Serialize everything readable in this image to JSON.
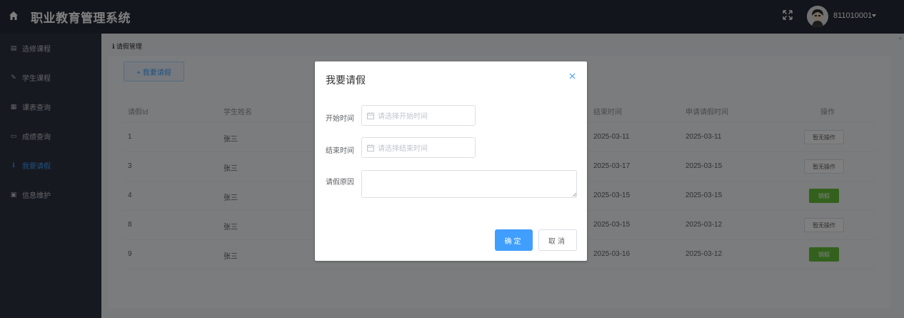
{
  "header": {
    "title": "职业教育管理系统",
    "username": "811010001",
    "home_icon": "home-icon",
    "fullscreen_icon": "fullscreen-icon"
  },
  "sidebar": {
    "items": [
      {
        "label": "选修课程",
        "icon": "book-icon"
      },
      {
        "label": "学生课程",
        "icon": "edit-icon"
      },
      {
        "label": "课表查询",
        "icon": "calendar-icon"
      },
      {
        "label": "成绩查询",
        "icon": "table-icon"
      },
      {
        "label": "我要请假",
        "icon": "info-icon",
        "active": true
      },
      {
        "label": "信息维护",
        "icon": "document-icon"
      }
    ]
  },
  "breadcrumb": "请假管理",
  "toolbar": {
    "add_label": "+ 我要请假"
  },
  "table": {
    "headers": [
      "请假Id",
      "学生姓名",
      "结束时间",
      "申请请假时间",
      "操作"
    ],
    "rows": [
      {
        "id": "1",
        "name": "张三",
        "end": "2025-03-11",
        "applied": "2025-03-11",
        "action": "暂无操作"
      },
      {
        "id": "3",
        "name": "张三",
        "end": "2025-03-17",
        "applied": "2025-03-15",
        "action": "暂无操作"
      },
      {
        "id": "4",
        "name": "张三",
        "end": "2025-03-15",
        "applied": "2025-03-15",
        "action": "销假"
      },
      {
        "id": "8",
        "name": "张三",
        "end": "2025-03-15",
        "applied": "2025-03-12",
        "action": "暂无操作"
      },
      {
        "id": "9",
        "name": "张三",
        "end": "2025-03-16",
        "applied": "2025-03-12",
        "action": "销假"
      }
    ]
  },
  "dialog": {
    "title": "我要请假",
    "start_label": "开始时间",
    "start_placeholder": "请选择开始时间",
    "end_label": "结束时间",
    "end_placeholder": "请选择结束时间",
    "reason_label": "请假原因",
    "reason_value": "",
    "ok_label": "确定",
    "cancel_label": "取消"
  },
  "colors": {
    "header_bg": "#242a37",
    "sidebar_bg": "#2e3340",
    "accent": "#409eff",
    "success": "#67c23a"
  }
}
